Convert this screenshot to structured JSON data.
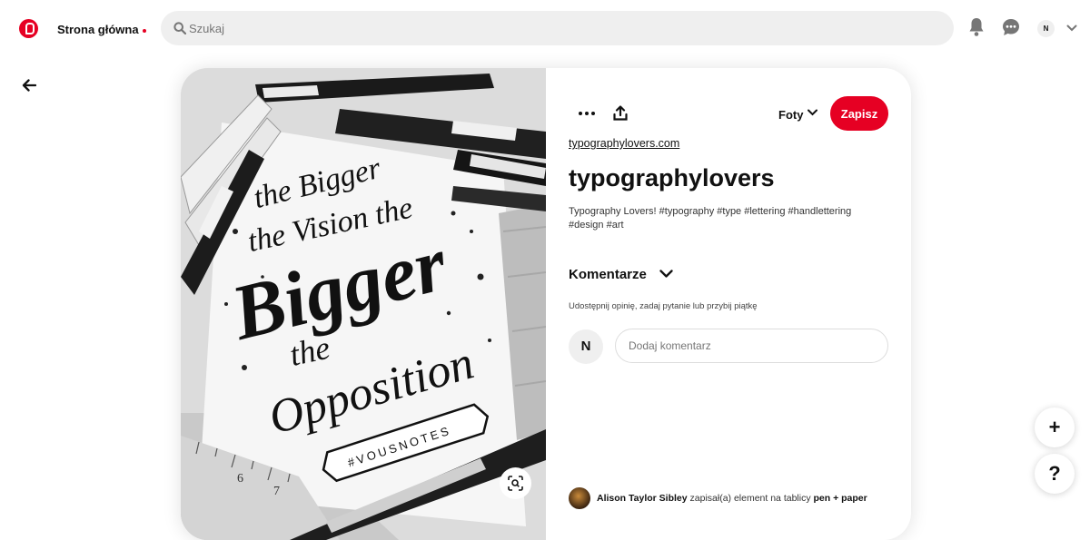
{
  "header": {
    "home_label": "Strona główna",
    "search_placeholder": "Szukaj",
    "user_initial": "N"
  },
  "pin": {
    "board_label": "Foty",
    "save_label": "Zapisz",
    "domain": "typographylovers.com",
    "title": "typographylovers",
    "description": "Typography Lovers! #typography #type #lettering #handlettering #design #art",
    "image_text": {
      "line1": "the Bigger",
      "line2": "the Vision the",
      "line3": "Bigger",
      "line4": "the",
      "line5": "Opposition",
      "banner": "#VOUSNOTES",
      "ruler_numbers": [
        "6",
        "7"
      ]
    }
  },
  "comments": {
    "heading": "Komentarze",
    "hint": "Udostępnij opinię, zadaj pytanie lub przybij piątkę",
    "avatar_initial": "N",
    "input_placeholder": "Dodaj komentarz"
  },
  "saver": {
    "name": "Alison Taylor Sibley",
    "action": " zapisał(a) element na tablicy ",
    "board": "pen + paper"
  },
  "floating": {
    "add_label": "+",
    "help_label": "?"
  },
  "colors": {
    "brand": "#e60023",
    "search_bg": "#efefef"
  }
}
